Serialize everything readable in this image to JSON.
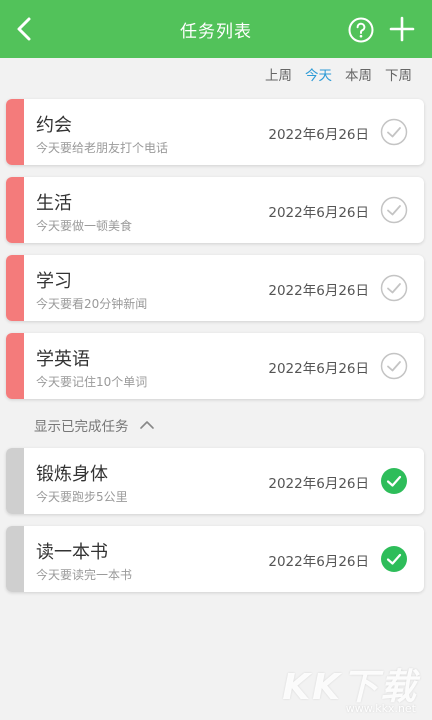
{
  "header": {
    "title": "任务列表",
    "background_color": "#52c25a",
    "back_icon": "chevron-left-icon",
    "help_icon": "question-circle-icon",
    "add_icon": "plus-icon"
  },
  "week_tabs": [
    {
      "label": "上周",
      "active": false
    },
    {
      "label": "今天",
      "active": true
    },
    {
      "label": "本周",
      "active": false
    },
    {
      "label": "下周",
      "active": false
    }
  ],
  "active_tab_color": "#2e9bd6",
  "pending_tasks": [
    {
      "title": "约会",
      "subtitle": "今天要给老朋友打个电话",
      "date": "2022年6月26日",
      "completed": false
    },
    {
      "title": "生活",
      "subtitle": "今天要做一顿美食",
      "date": "2022年6月26日",
      "completed": false
    },
    {
      "title": "学习",
      "subtitle": "今天要看20分钟新闻",
      "date": "2022年6月26日",
      "completed": false
    },
    {
      "title": "学英语",
      "subtitle": "今天要记住10个单词",
      "date": "2022年6月26日",
      "completed": false
    }
  ],
  "completed_section": {
    "toggle_label": "显示已完成任务",
    "toggle_icon": "chevron-up-icon"
  },
  "completed_tasks": [
    {
      "title": "锻炼身体",
      "subtitle": "今天要跑步5公里",
      "date": "2022年6月26日",
      "completed": true
    },
    {
      "title": "读一本书",
      "subtitle": "今天要读完一本书",
      "date": "2022年6月26日",
      "completed": true
    }
  ],
  "colors": {
    "pending_bar": "#f47b7b",
    "completed_bar": "#cfcfcf",
    "check_done": "#2ebd5a"
  },
  "watermark": {
    "logo_text": "KK下载",
    "url": "www.kkx.net"
  }
}
